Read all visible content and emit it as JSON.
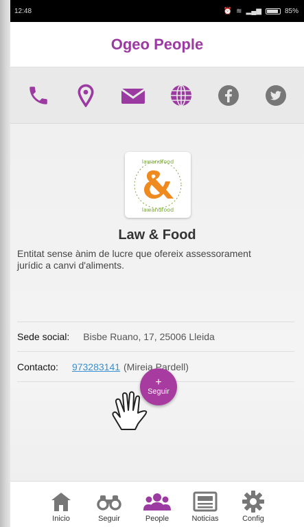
{
  "status": {
    "time": "12:48",
    "battery": "85%"
  },
  "appbar": {
    "title": "Ogeo People"
  },
  "actions": [
    "phone-icon",
    "location-pin-icon",
    "mail-icon",
    "globe-icon",
    "facebook-icon",
    "twitter-icon"
  ],
  "colors": {
    "accent": "#9b3aa0",
    "inactive": "#777777",
    "link": "#3a8fd0"
  },
  "profile": {
    "logo_text": "lawandfood",
    "name": "Law & Food",
    "description": "Entitat sense ànim de lucre que ofereix assessorament jurídic a canvi d'aliments."
  },
  "details": {
    "sede_label": "Sede social:",
    "sede_value": "Bisbe Ruano, 17, 25006 Lleida",
    "contacto_label": "Contacto:",
    "contacto_phone": "973283141",
    "contacto_name": "(Mireia Pardell)"
  },
  "follow_button": {
    "plus": "+",
    "label": "Seguir"
  },
  "bottom_nav": [
    {
      "label": "Inicio",
      "icon": "home-icon"
    },
    {
      "label": "Seguir",
      "icon": "binoculars-icon"
    },
    {
      "label": "People",
      "icon": "people-icon",
      "active": true
    },
    {
      "label": "Noticias",
      "icon": "newspaper-icon"
    },
    {
      "label": "Config",
      "icon": "gear-icon"
    }
  ]
}
